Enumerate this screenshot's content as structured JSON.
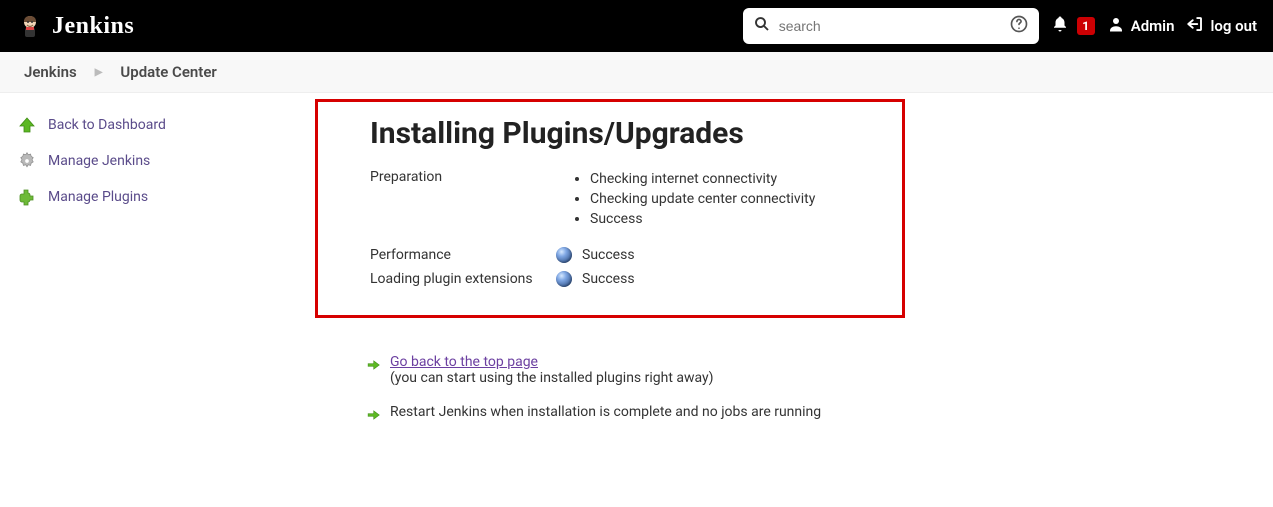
{
  "header": {
    "brand": "Jenkins",
    "search_placeholder": "search",
    "alert_count": "1",
    "user_name": "Admin",
    "logout_label": "log out"
  },
  "breadcrumb": {
    "items": [
      "Jenkins",
      "Update Center"
    ]
  },
  "sidebar": {
    "items": [
      {
        "label": "Back to Dashboard"
      },
      {
        "label": "Manage Jenkins"
      },
      {
        "label": "Manage Plugins"
      }
    ]
  },
  "main": {
    "title": "Installing Plugins/Upgrades",
    "preparation_label": "Preparation",
    "preparation_steps": [
      "Checking internet connectivity",
      "Checking update center connectivity",
      "Success"
    ],
    "performance_label": "Performance",
    "performance_status": "Success",
    "loading_label": "Loading plugin extensions",
    "loading_status": "Success"
  },
  "actions": {
    "go_back_link": "Go back to the top page",
    "go_back_sub": "(you can start using the installed plugins right away)",
    "restart_text": "Restart Jenkins when installation is complete and no jobs are running"
  }
}
